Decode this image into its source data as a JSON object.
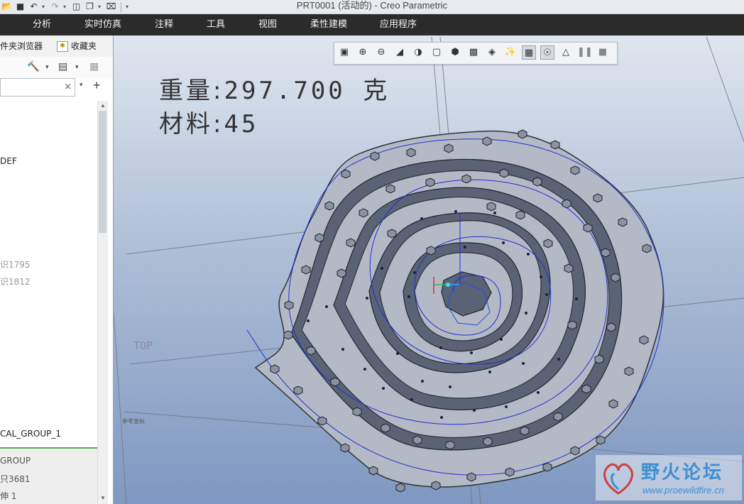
{
  "window": {
    "title": "PRT0001 (活动的) - Creo Parametric"
  },
  "quick_access": {
    "icons": [
      "open-icon",
      "save-icon",
      "undo-icon",
      "redo-icon",
      "regenerate-icon",
      "windows-icon",
      "close-window-icon",
      "customize-icon"
    ]
  },
  "menu": {
    "items": [
      "分析",
      "实时仿真",
      "注释",
      "工具",
      "视图",
      "柔性建模",
      "应用程序"
    ]
  },
  "left_panel": {
    "tabs": {
      "folder_browser": "文件夹浏览器",
      "favorites": "收藏夹"
    },
    "search": {
      "value": "",
      "clear": "×"
    },
    "tree": {
      "item_def": "DEF",
      "item_1795": "识1795",
      "item_1812": "识1812",
      "item_group1": "CAL_GROUP_1",
      "item_group": "GROUP",
      "item_3681": "只3681",
      "item_extrude": "伸 1"
    }
  },
  "viewport": {
    "weight_label": "重量:",
    "weight_value": "297.700 克",
    "material_label": "材料:",
    "material_value": "45",
    "datum_plane_label": "TOP",
    "csys_label": "参考坐标"
  },
  "view_toolbar": {
    "buttons": [
      "refit-icon",
      "zoom-in-icon",
      "zoom-out-icon",
      "repaint-icon",
      "shading-icon",
      "saved-views-icon",
      "view-manager-icon",
      "display-style-icon",
      "perspective-icon",
      "datum-display-icon",
      "annotation-icon",
      "spin-center-icon",
      "simulation-icon",
      "pause-icon",
      "stop-icon"
    ]
  },
  "watermark": {
    "text": "野火论坛",
    "url": "www.proewildfire.cn"
  },
  "colors": {
    "menubar": "#2b2b2b",
    "viewport_top": "#dfe6ef",
    "viewport_bottom": "#7f98c1",
    "spiral_fill": "#b4bac5",
    "curve": "#1f2fd8",
    "watermark": "#3d8fd2",
    "tree_green": "#4caf50"
  }
}
